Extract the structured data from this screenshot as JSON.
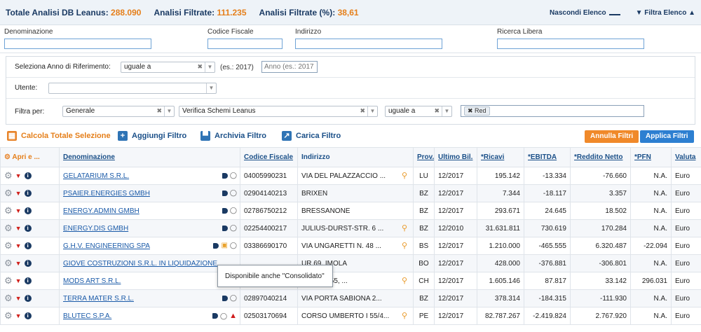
{
  "stats": {
    "totale_label": "Totale Analisi DB Leanus:",
    "totale_value": "288.090",
    "filtrate_label": "Analisi Filtrate:",
    "filtrate_value": "111.235",
    "perc_label": "Analisi Filtrate (%):",
    "perc_value": "38,61"
  },
  "top_actions": {
    "hide_list": "Nascondi Elenco",
    "filter_list": "Filtra Elenco"
  },
  "search_fields": {
    "denominazione": "Denominazione",
    "codice_fiscale": "Codice Fiscale",
    "indirizzo": "Indirizzo",
    "ricerca_libera": "Ricerca Libera"
  },
  "panel": {
    "anno_label": "Seleziona Anno di Riferimento:",
    "anno_operator": "uguale a",
    "anno_example": "(es.: 2017)",
    "anno_placeholder": "Anno (es.: 2017",
    "utente_label": "Utente:",
    "utente_value": "",
    "filtra_label": "Filtra per:",
    "filtra_category": "Generale",
    "filtra_field": "Verifica Schemi Leanus",
    "filtra_operator": "uguale a",
    "filtra_tag": "Red"
  },
  "toolbar": {
    "calcola": "Calcola Totale Selezione",
    "aggiungi": "Aggiungi Filtro",
    "archivia": "Archivia Filtro",
    "carica": "Carica Filtro",
    "annulla": "Annulla Filtri",
    "applica": "Applica Filtri"
  },
  "table": {
    "headers": {
      "apri": "Apri e ...",
      "denominazione": "Denominazione",
      "codice_fiscale": "Codice Fiscale",
      "indirizzo": "Indirizzo",
      "prov": "Prov.",
      "ultimo_bil": "Ultimo Bil.",
      "ricavi": "*Ricavi",
      "ebitda": "*EBITDA",
      "reddito_netto": "*Reddito Netto",
      "pfn": "*PFN",
      "valuta": "Valuta"
    },
    "rows": [
      {
        "name": "GELATARIUM S.R.L.",
        "cf": "04005990231",
        "addr": "VIA DEL PALAZZACCIO ...",
        "prov": "LU",
        "bil": "12/2017",
        "ricavi": "195.142",
        "ebitda": "-13.334",
        "reddito": "-76.660",
        "pfn": "N.A.",
        "valuta": "Euro"
      },
      {
        "name": "PSAIER.ENERGIES GMBH",
        "cf": "02904140213",
        "addr": "BRIXEN",
        "prov": "BZ",
        "bil": "12/2017",
        "ricavi": "7.344",
        "ebitda": "-18.117",
        "reddito": "3.357",
        "pfn": "N.A.",
        "valuta": "Euro"
      },
      {
        "name": "ENERGY.ADMIN GMBH",
        "cf": "02786750212",
        "addr": "BRESSANONE",
        "prov": "BZ",
        "bil": "12/2017",
        "ricavi": "293.671",
        "ebitda": "24.645",
        "reddito": "18.502",
        "pfn": "N.A.",
        "valuta": "Euro"
      },
      {
        "name": "ENERGY.DIS GMBH",
        "cf": "02254400217",
        "addr": "JULIUS-DURST-STR. 6 ...",
        "prov": "BZ",
        "bil": "12/2010",
        "ricavi": "31.631.811",
        "ebitda": "730.619",
        "reddito": "170.284",
        "pfn": "N.A.",
        "valuta": "Euro"
      },
      {
        "name": "G.H.V. ENGINEERING SPA",
        "cf": "03386690170",
        "addr": "VIA UNGARETTI N. 48 ...",
        "prov": "BS",
        "bil": "12/2017",
        "ricavi": "1.210.000",
        "ebitda": "-465.555",
        "reddito": "6.320.487",
        "pfn": "-22.094",
        "valuta": "Euro"
      },
      {
        "name": "GIOVE COSTRUZIONI S.R.L. IN LIQUIDAZIONE",
        "cf": "",
        "addr": "UR 69, IMOLA",
        "prov": "BO",
        "bil": "12/2017",
        "ricavi": "428.000",
        "ebitda": "-376.881",
        "reddito": "-306.801",
        "pfn": "N.A.",
        "valuta": "Euro"
      },
      {
        "name": "MODS ART S.R.L.",
        "cf": "",
        "addr": "ONATA 155, ...",
        "prov": "CH",
        "bil": "12/2017",
        "ricavi": "1.605.146",
        "ebitda": "87.817",
        "reddito": "33.142",
        "pfn": "296.031",
        "valuta": "Euro"
      },
      {
        "name": "TERRA MATER S.R.L.",
        "cf": "02897040214",
        "addr": "VIA PORTA SABIONA 2...",
        "prov": "BZ",
        "bil": "12/2017",
        "ricavi": "378.314",
        "ebitda": "-184.315",
        "reddito": "-111.930",
        "pfn": "N.A.",
        "valuta": "Euro"
      },
      {
        "name": "BLUTEC S.P.A.",
        "cf": "02503170694",
        "addr": "CORSO UMBERTO I 55/4...",
        "prov": "PE",
        "bil": "12/2017",
        "ricavi": "82.787.267",
        "ebitda": "-2.419.824",
        "reddito": "2.767.920",
        "pfn": "N.A.",
        "valuta": "Euro"
      }
    ]
  },
  "tooltip": "Disponibile anche \"Consolidato\"",
  "icons": [
    "gear-icon",
    "caret-down-icon",
    "info-icon",
    "tag-icon",
    "chat-icon",
    "consolidated-doc-icon",
    "warning-icon",
    "map-pin-icon",
    "calculator-icon",
    "plus-icon",
    "save-icon",
    "upload-icon",
    "filter-icon"
  ],
  "colors": {
    "accent": "#e57f1a",
    "brand": "#1a3a63",
    "link": "#1a5aa8"
  }
}
